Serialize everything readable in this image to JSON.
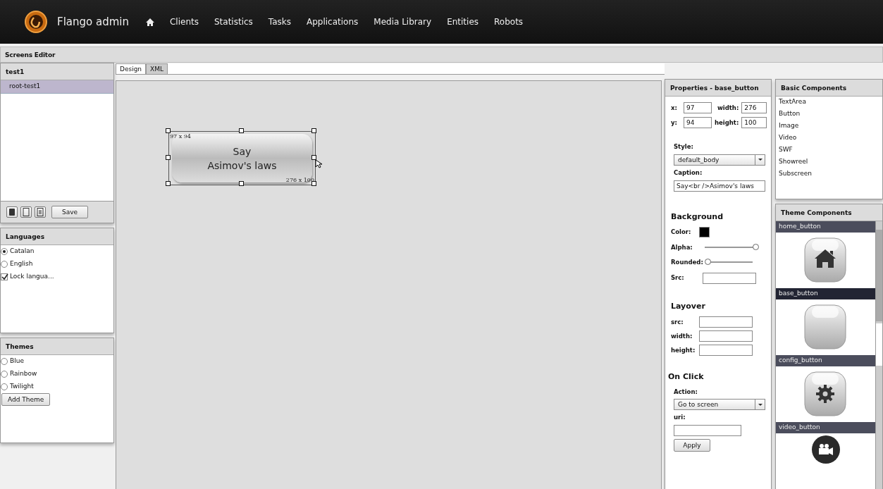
{
  "navbar": {
    "brand": "Flango admin",
    "items": [
      {
        "kind": "home"
      },
      {
        "label": "Clients"
      },
      {
        "label": "Statistics"
      },
      {
        "label": "Tasks"
      },
      {
        "label": "Applications"
      },
      {
        "label": "Media Library"
      },
      {
        "label": "Entities"
      },
      {
        "label": "Robots"
      }
    ]
  },
  "editor": {
    "title": "Screens Editor"
  },
  "screen_panel": {
    "title": "test1",
    "items": [
      {
        "label": "root-test1",
        "selected": true
      }
    ],
    "save": "Save"
  },
  "languages": {
    "title": "Languages",
    "options": [
      {
        "kind": "radio",
        "label": "Catalan",
        "checked": true
      },
      {
        "kind": "radio",
        "label": "English",
        "checked": false
      },
      {
        "kind": "checkbox",
        "label": "Lock langua...",
        "checked": true
      }
    ]
  },
  "themes": {
    "title": "Themes",
    "options": [
      {
        "label": "Blue",
        "checked": false
      },
      {
        "label": "Rainbow",
        "checked": false
      },
      {
        "label": "Twilight",
        "checked": false
      }
    ],
    "add": "Add Theme"
  },
  "tabs": [
    {
      "label": "Design",
      "selected": true
    },
    {
      "label": "XML",
      "selected": false
    }
  ],
  "canvas": {
    "element": {
      "caption_lines": [
        "Say",
        "Asimov's laws"
      ],
      "position": "97 x 94",
      "size": "276 x 100",
      "selected": true
    }
  },
  "properties": {
    "title": "Properties - base_button",
    "geometry": [
      {
        "label": "x:",
        "value": "97"
      },
      {
        "label": "width:",
        "value": "276"
      },
      {
        "label": "y:",
        "value": "94"
      },
      {
        "label": "height:",
        "value": "100"
      }
    ],
    "style_label": "Style:",
    "style_value": "default_body",
    "caption_label": "Caption:",
    "caption_value": "Say<br />Asimov's laws",
    "background": {
      "heading": "Background",
      "color_label": "Color:",
      "color": "#000000",
      "alpha_label": "Alpha:",
      "alpha": {
        "level": 1
      },
      "rounded_label": "Rounded:",
      "rounded": {
        "level": 0
      },
      "src_label": "Src:"
    },
    "layover": {
      "heading": "Layover",
      "fields": [
        {
          "label": "src:"
        },
        {
          "label": "width:"
        },
        {
          "label": "height:"
        }
      ]
    },
    "on_click": {
      "heading": "On Click",
      "action_label": "Action:",
      "action_value": "Go to screen",
      "uri_label": "uri:",
      "apply": "Apply"
    }
  },
  "basic_components": {
    "title": "Basic Components",
    "items": [
      "TextArea",
      "Button",
      "Image",
      "Video",
      "SWF",
      "Showreel",
      "Subscreen"
    ]
  },
  "theme_components": {
    "title": "Theme Components",
    "items": [
      {
        "label": "home_button",
        "kind": "home",
        "selected": false
      },
      {
        "label": "base_button",
        "kind": "blank",
        "selected": true
      },
      {
        "label": "config_button",
        "kind": "gear",
        "selected": false
      },
      {
        "label": "video_button",
        "kind": "video",
        "selected": false
      }
    ]
  }
}
